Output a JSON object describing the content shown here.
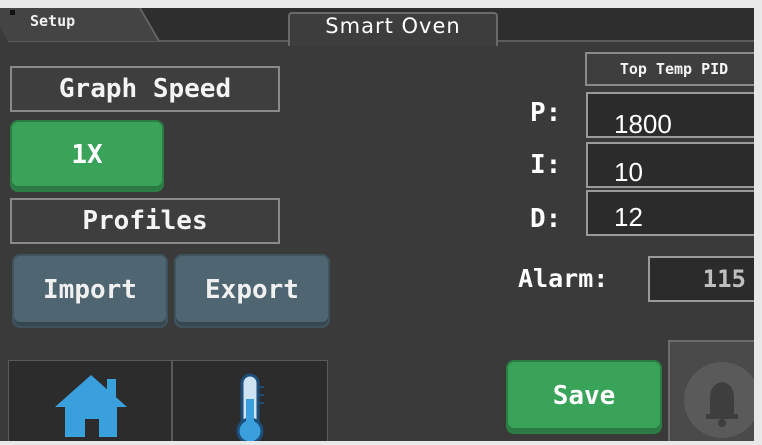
{
  "header": {
    "setup_label": "Setup",
    "title": "Smart Oven"
  },
  "left_panel": {
    "graph_speed_label": "Graph Speed",
    "graph_speed_value": "1X",
    "profiles_label": "Profiles",
    "import_label": "Import",
    "export_label": "Export"
  },
  "pid": {
    "heading": "Top Temp PID",
    "p_label": "P:",
    "p_value": "1800",
    "i_label": "I:",
    "i_value": "10",
    "d_label": "D:",
    "d_value": "12"
  },
  "alarm": {
    "label": "Alarm:",
    "value": "115"
  },
  "actions": {
    "save_label": "Save"
  },
  "nav": {
    "home_icon": "home-icon",
    "thermometer_icon": "thermometer-icon",
    "bell_icon": "bell-icon"
  },
  "colors": {
    "accent_green": "#3aa35a",
    "slate_button": "#4f6672",
    "home_blue": "#3aa0dd",
    "background": "#3a3a3a"
  }
}
